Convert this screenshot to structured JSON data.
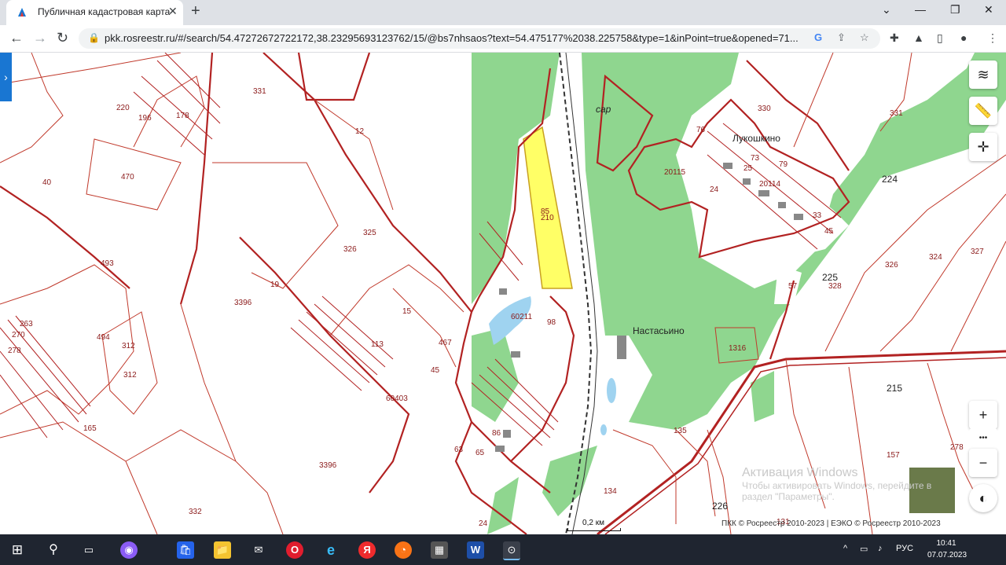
{
  "browser": {
    "tab_title": "Публичная кадастровая карта",
    "url": "pkk.rosreestr.ru/#/search/54.47272672722172,38.23295693123762/15/@bs7nhsaos?text=54.475177%2038.225758&type=1&inPoint=true&opened=71...",
    "close_glyph": "✕",
    "new_tab_glyph": "+",
    "back_glyph": "←",
    "forward_glyph": "→",
    "reload_glyph": "↻",
    "lock_glyph": "🔒",
    "minimize_glyph": "—",
    "maximize_glyph": "❐",
    "window_close_glyph": "✕",
    "dropdown_glyph": "⌄",
    "google_glyph": "G",
    "share_glyph": "⇪",
    "star_glyph": "☆",
    "puzzle_glyph": "✚",
    "flask_glyph": "▲",
    "sidepanel_glyph": "▯",
    "profile_glyph": "●",
    "menu_glyph": "⋮"
  },
  "map": {
    "places": [
      "Лукошкино",
      "Настасьино",
      "сар"
    ],
    "parcels": [
      "331",
      "12",
      "40",
      "470",
      "196",
      "178",
      "220",
      "493",
      "325",
      "326",
      "19",
      "3396",
      "312",
      "312",
      "494",
      "263",
      "270",
      "278",
      "165",
      "332",
      "3396",
      "60403",
      "15",
      "113",
      "467",
      "45",
      "63",
      "65",
      "86",
      "60211",
      "98",
      "85",
      "210",
      "76",
      "330",
      "331",
      "20115",
      "20114",
      "73",
      "79",
      "25",
      "24",
      "33",
      "45",
      "224",
      "225",
      "328",
      "326",
      "324",
      "327",
      "57",
      "1316",
      "215",
      "135",
      "134",
      "226",
      "157",
      "278",
      "17",
      "24",
      "131"
    ],
    "scale_label": "0,2 км",
    "attribution": "ПКК © Росреестр 2010-2023 | ЕЭКО © Росреестр 2010-2023",
    "watermark": [
      "Активация Windows",
      "Чтобы активировать Windows, перейдите в",
      "раздел \"Параметры\"."
    ],
    "controls": {
      "layers": "≋",
      "measure": "📏",
      "locate": "✛",
      "zoom_in": "+",
      "more": "•••",
      "zoom_out": "−",
      "compass": "◐",
      "side_toggle": "›"
    }
  },
  "taskbar": {
    "start": "⊞",
    "search": "⚲",
    "taskview": "▭",
    "apps": [
      "◉",
      "🛍",
      "📁",
      "✉",
      "O",
      "e",
      "Я",
      "◔",
      "▦",
      "W",
      "⊙"
    ],
    "tray_up": "^",
    "tray_battery": "▭",
    "tray_volume": "♪",
    "language": "РУС",
    "time": "10:41",
    "date": "07.07.2023"
  }
}
